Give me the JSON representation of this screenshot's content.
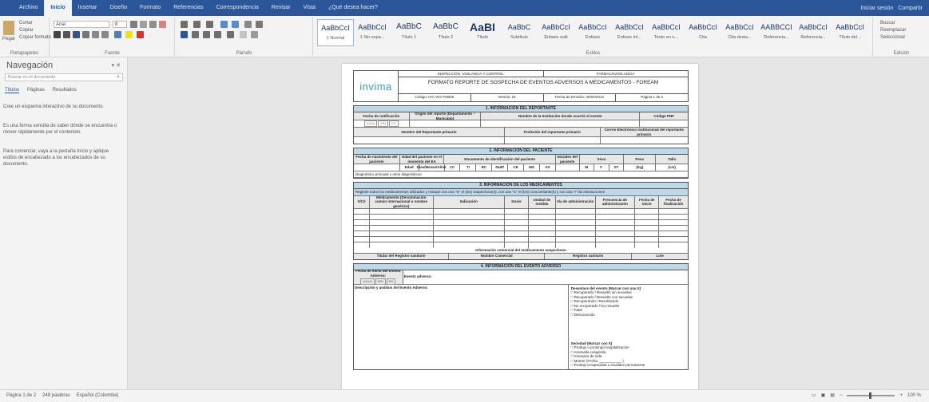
{
  "tabs": [
    "Archivo",
    "Inicio",
    "Insertar",
    "Diseño",
    "Formato",
    "Referencias",
    "Correspondencia",
    "Revisar",
    "Vista",
    "¿Qué desea hacer?"
  ],
  "account": {
    "user": "Iniciar sesión",
    "share": "Compartir"
  },
  "ribbon": {
    "clipboard": {
      "paste": "Pegar",
      "cut": "Cortar",
      "copy": "Copiar",
      "format_painter": "Copiar formato",
      "label": "Portapapeles"
    },
    "font": {
      "name": "Arial",
      "size": "8",
      "label": "Fuente"
    },
    "paragraph": {
      "label": "Párrafo"
    },
    "styles": {
      "label": "Estilos",
      "items": [
        {
          "sample": "AaBbCcI",
          "name": "1 Normal"
        },
        {
          "sample": "AaBbCcI",
          "name": "1 Sin espa..."
        },
        {
          "sample": "AaBbC",
          "name": "Título 1"
        },
        {
          "sample": "AaBbC",
          "name": "Título 2"
        },
        {
          "sample": "AaBI",
          "name": "Título"
        },
        {
          "sample": "AaBbC",
          "name": "Subtítulo"
        },
        {
          "sample": "AaBbCcI",
          "name": "Énfasis sutil"
        },
        {
          "sample": "AaBbCcI",
          "name": "Énfasis"
        },
        {
          "sample": "AaBbCcI",
          "name": "Énfasis int..."
        },
        {
          "sample": "AaBbCcI",
          "name": "Texto en n..."
        },
        {
          "sample": "AaBbCcI",
          "name": "Cita"
        },
        {
          "sample": "AaBbCcI",
          "name": "Cita desta..."
        },
        {
          "sample": "AABBCCI",
          "name": "Referencia..."
        },
        {
          "sample": "AaBbCcI",
          "name": "Referencia..."
        },
        {
          "sample": "AaBbCcI",
          "name": "Título del..."
        }
      ]
    },
    "editing": {
      "find": "Buscar",
      "replace": "Reemplazar",
      "select": "Seleccionar",
      "label": "Edición"
    }
  },
  "nav": {
    "title": "Navegación",
    "search_placeholder": "Buscar en el documento",
    "tabs": [
      "Títulos",
      "Páginas",
      "Resultados"
    ],
    "paragraphs": [
      "Cree un esquema interactivo de su documento.",
      "Es una forma sencilla de saber dónde se encuentra o mover rápidamente por el contenido.",
      "Para comenzar, vaya a la pestaña Inicio y aplique estilos de encabezado a los encabezados de su documento."
    ]
  },
  "form": {
    "logo": "invima",
    "top_row": [
      "INSPECCIÓN, VIGILANCIA Y CONTROL",
      "FARMACOVIGILANCIA"
    ],
    "title": "FORMATO REPORTE DE SOSPECHA DE EVENTOS ADVERSOS A MEDICAMENTOS - FOREAM",
    "meta_row": [
      "Código: IVC-VIG-FM026",
      "Versión: 01",
      "Fecha de Emisión: 30/04/2014",
      "Página 1 de 2"
    ],
    "s1": {
      "header": "1.    INFORMACIÓN DEL REPORTANTE",
      "row1": [
        "Fecha de notificación",
        "Origen del reporte\n(Departamento – Municipio)",
        "Nombre de la Institución donde ocurrió el evento",
        "Código PNF"
      ],
      "row2": [
        "Nombre del Reportante primario",
        "Profesión del reportante primario",
        "Correo Electrónico institucional del reportante primario"
      ],
      "date": [
        "AAAA",
        "MM",
        "DD"
      ]
    },
    "s2": {
      "header": "2.    INFORMACIÓN DEL PACIENTE",
      "head": [
        "Fecha de nacimiento del paciente",
        "Edad del paciente en el momento del EA",
        "Documento de identificación del paciente",
        "Iniciales del paciente",
        "Sexo",
        "Peso",
        "Talla"
      ],
      "sub": [
        "Edad",
        "Días/Meses/Años",
        "CC",
        "TI",
        "RC",
        "NUIP",
        "CE",
        "MS",
        "AS",
        "M",
        "F",
        "ST",
        "(Kg)",
        "(cm)"
      ],
      "diagnosis": "Diagnóstico principal y otros diagnósticos:"
    },
    "s3": {
      "header": "3.    INFORMACIÓN DE LOS MEDICAMENTOS",
      "note": "Registre todos los medicamentos utilizados y marque con una \"S\" el (los) sospechoso(s), con una \"C\" el (los) concomitante(s) y con una \"I\" las interacciones",
      "cols": [
        "S/C/I",
        "Medicamento\n(Denominación común internacional o nombre genérico)",
        "Indicación",
        "Dosis",
        "Unidad de medida",
        "Vía de administración",
        "Frecuencia de administración",
        "Fecha de inicio",
        "Fecha de finalización"
      ],
      "commercial": "Información comercial del medicamento sospechoso",
      "commercial_cols": [
        "Titular del Registro sanitario",
        "Nombre Comercial",
        "Registro sanitario",
        "Lote"
      ]
    },
    "s4": {
      "header": "4.    INFORMACIÓN DEL EVENTO ADVERSO",
      "start": "Fecha de inicio del Evento Adverso:",
      "event": "Evento adverso:",
      "desc": "Descripción y análisis del Evento Adverso:",
      "outcome_title": "Desenlace del evento (Marcar con una X)",
      "outcomes": [
        "Recuperado / Resuelto sin secuelas",
        "Recuperado / Resuelto con secuelas",
        "Recuperando / Resolviendo",
        "No recuperado / No resuelto",
        "Fatal",
        "Desconocido"
      ],
      "serious_title": "Seriedad (Marcar con X)",
      "serious": [
        "Produjo o prolongó hospitalización",
        "Anomalía congénita",
        "Amenaza de vida",
        "Muerte (Fecha: ___________ )",
        "Produjo incapacidad o invalidez permanente"
      ]
    }
  },
  "status": {
    "page": "Página 1 de 2",
    "words": "248 palabras",
    "lang": "Español (Colombia)",
    "zoom": "100 %"
  }
}
